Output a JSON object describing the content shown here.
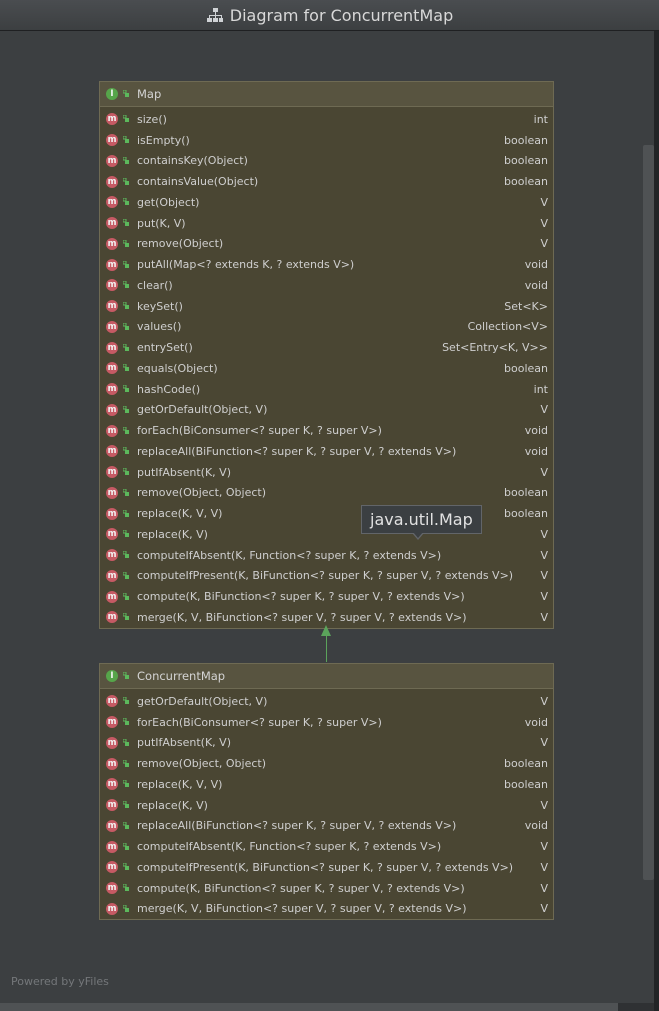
{
  "window": {
    "title": "Diagram for ConcurrentMap"
  },
  "colors": {
    "node_fill": "#4a4633",
    "node_header": "#585440",
    "node_border": "#6e6a53",
    "method_badge": "#c65a64",
    "interface_badge": "#56a54a",
    "edge": "#5ba35b",
    "canvas": "#3c3f41"
  },
  "nodes": {
    "map": {
      "name": "Map",
      "kind_letter": "I",
      "methods": [
        {
          "name": "size()",
          "type": "int"
        },
        {
          "name": "isEmpty()",
          "type": "boolean"
        },
        {
          "name": "containsKey(Object)",
          "type": "boolean"
        },
        {
          "name": "containsValue(Object)",
          "type": "boolean"
        },
        {
          "name": "get(Object)",
          "type": "V"
        },
        {
          "name": "put(K, V)",
          "type": "V"
        },
        {
          "name": "remove(Object)",
          "type": "V"
        },
        {
          "name": "putAll(Map<? extends K, ? extends V>)",
          "type": "void"
        },
        {
          "name": "clear()",
          "type": "void"
        },
        {
          "name": "keySet()",
          "type": "Set<K>"
        },
        {
          "name": "values()",
          "type": "Collection<V>"
        },
        {
          "name": "entrySet()",
          "type": "Set<Entry<K, V>>"
        },
        {
          "name": "equals(Object)",
          "type": "boolean"
        },
        {
          "name": "hashCode()",
          "type": "int"
        },
        {
          "name": "getOrDefault(Object, V)",
          "type": "V"
        },
        {
          "name": "forEach(BiConsumer<? super K, ? super V>)",
          "type": "void"
        },
        {
          "name": "replaceAll(BiFunction<? super K, ? super V, ? extends V>)",
          "type": "void"
        },
        {
          "name": "putIfAbsent(K, V)",
          "type": "V"
        },
        {
          "name": "remove(Object, Object)",
          "type": "boolean"
        },
        {
          "name": "replace(K, V, V)",
          "type": "boolean"
        },
        {
          "name": "replace(K, V)",
          "type": "V"
        },
        {
          "name": "computeIfAbsent(K, Function<? super K, ? extends V>)",
          "type": "V"
        },
        {
          "name": "computeIfPresent(K, BiFunction<? super K, ? super V, ? extends V>)",
          "type": "V"
        },
        {
          "name": "compute(K, BiFunction<? super K, ? super V, ? extends V>)",
          "type": "V"
        },
        {
          "name": "merge(K, V, BiFunction<? super V, ? super V, ? extends V>)",
          "type": "V"
        }
      ]
    },
    "concurrent_map": {
      "name": "ConcurrentMap",
      "kind_letter": "I",
      "methods": [
        {
          "name": "getOrDefault(Object, V)",
          "type": "V"
        },
        {
          "name": "forEach(BiConsumer<? super K, ? super V>)",
          "type": "void"
        },
        {
          "name": "putIfAbsent(K, V)",
          "type": "V"
        },
        {
          "name": "remove(Object, Object)",
          "type": "boolean"
        },
        {
          "name": "replace(K, V, V)",
          "type": "boolean"
        },
        {
          "name": "replace(K, V)",
          "type": "V"
        },
        {
          "name": "replaceAll(BiFunction<? super K, ? super V, ? extends V>)",
          "type": "void"
        },
        {
          "name": "computeIfAbsent(K, Function<? super K, ? extends V>)",
          "type": "V"
        },
        {
          "name": "computeIfPresent(K, BiFunction<? super K, ? super V, ? extends V>)",
          "type": "V"
        },
        {
          "name": "compute(K, BiFunction<? super K, ? super V, ? extends V>)",
          "type": "V"
        },
        {
          "name": "merge(K, V, BiFunction<? super V, ? super V, ? extends V>)",
          "type": "V"
        }
      ]
    }
  },
  "method_badge_letter": "m",
  "tooltip": {
    "text": "java.util.Map"
  },
  "footer": {
    "text": "Powered by yFiles"
  }
}
